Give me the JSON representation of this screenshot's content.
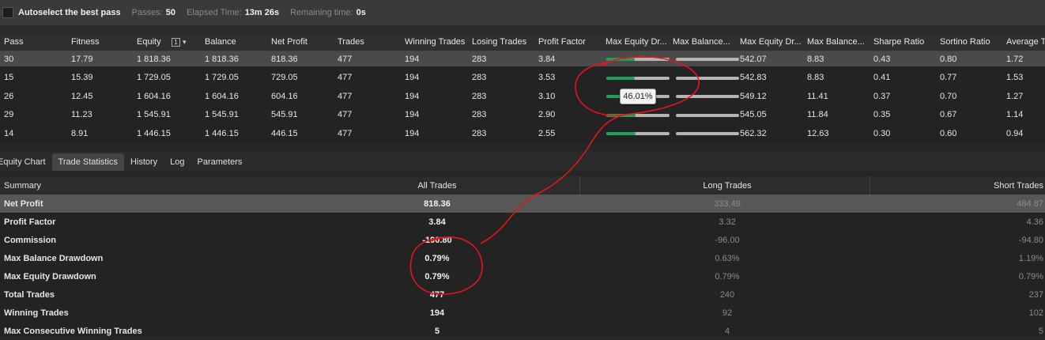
{
  "topbar": {
    "autoselect_label": "Autoselect the best pass",
    "passes_key": "Passes:",
    "passes_value": "50",
    "elapsed_key": "Elapsed Time:",
    "elapsed_value": "13m 26s",
    "remaining_key": "Remaining time:",
    "remaining_value": "0s"
  },
  "grid": {
    "columns": [
      "Pass",
      "Fitness",
      "Equity",
      "Balance",
      "Net Profit",
      "Trades",
      "Winning Trades",
      "Losing Trades",
      "Profit Factor",
      "Max Equity Dr...",
      "Max Balance...",
      "Max Equity Dr...",
      "Max Balance...",
      "Sharpe Ratio",
      "Sortino Ratio",
      "Average T"
    ],
    "equity_sort_badge": "1",
    "equity_sort_arrow": "▾",
    "rows": [
      {
        "pass": "30",
        "fitness": "17.79",
        "equity": "1 818.36",
        "balance": "1 818.36",
        "net_profit": "818.36",
        "trades": "477",
        "winning": "194",
        "losing": "283",
        "profit_factor": "3.84",
        "max_equity_dd_fill": 0.45,
        "max_balance_dd_fill": 0.0,
        "max_equity_dd_abs": "542.07",
        "max_balance_dd_abs": "8.83",
        "sharpe": "0.43",
        "sortino": "0.80",
        "average": "1.72"
      },
      {
        "pass": "15",
        "fitness": "15.39",
        "equity": "1 729.05",
        "balance": "1 729.05",
        "net_profit": "729.05",
        "trades": "477",
        "winning": "194",
        "losing": "283",
        "profit_factor": "3.53",
        "max_equity_dd_fill": 0.45,
        "max_balance_dd_fill": 0.0,
        "max_equity_dd_abs": "542.83",
        "max_balance_dd_abs": "8.83",
        "sharpe": "0.41",
        "sortino": "0.77",
        "average": "1.53"
      },
      {
        "pass": "26",
        "fitness": "12.45",
        "equity": "1 604.16",
        "balance": "1 604.16",
        "net_profit": "604.16",
        "trades": "477",
        "winning": "194",
        "losing": "283",
        "profit_factor": "3.10",
        "max_equity_dd_fill": 0.46,
        "max_balance_dd_fill": 0.0,
        "max_equity_dd_abs": "549.12",
        "max_balance_dd_abs": "11.41",
        "sharpe": "0.37",
        "sortino": "0.70",
        "average": "1.27"
      },
      {
        "pass": "29",
        "fitness": "11.23",
        "equity": "1 545.91",
        "balance": "1 545.91",
        "net_profit": "545.91",
        "trades": "477",
        "winning": "194",
        "losing": "283",
        "profit_factor": "2.90",
        "max_equity_dd_fill": 0.46,
        "max_balance_dd_fill": 0.0,
        "max_equity_dd_abs": "545.05",
        "max_balance_dd_abs": "11.84",
        "sharpe": "0.35",
        "sortino": "0.67",
        "average": "1.14"
      },
      {
        "pass": "14",
        "fitness": "8.91",
        "equity": "1 446.15",
        "balance": "1 446.15",
        "net_profit": "446.15",
        "trades": "477",
        "winning": "194",
        "losing": "283",
        "profit_factor": "2.55",
        "max_equity_dd_fill": 0.46,
        "max_balance_dd_fill": 0.0,
        "max_equity_dd_abs": "562.32",
        "max_balance_dd_abs": "12.63",
        "sharpe": "0.30",
        "sortino": "0.60",
        "average": "0.94"
      }
    ],
    "tooltip": "46.01%"
  },
  "tabs": [
    "Equity Chart",
    "Trade Statistics",
    "History",
    "Log",
    "Parameters"
  ],
  "active_tab": "Trade Statistics",
  "stats": {
    "headers": {
      "summary": "Summary",
      "all": "All Trades",
      "long": "Long Trades",
      "short": "Short Trades"
    },
    "rows": [
      {
        "label": "Net Profit",
        "all": "818.36",
        "long": "333.49",
        "short": "484.87"
      },
      {
        "label": "Profit Factor",
        "all": "3.84",
        "long": "3.32",
        "short": "4.36"
      },
      {
        "label": "Commission",
        "all": "-190.80",
        "long": "-96.00",
        "short": "-94.80"
      },
      {
        "label": "Max Balance Drawdown",
        "all": "0.79%",
        "long": "0.63%",
        "short": "1.19%"
      },
      {
        "label": "Max Equity Drawdown",
        "all": "0.79%",
        "long": "0.79%",
        "short": "0.79%"
      },
      {
        "label": "Total Trades",
        "all": "477",
        "long": "240",
        "short": "237"
      },
      {
        "label": "Winning Trades",
        "all": "194",
        "long": "92",
        "short": "102"
      },
      {
        "label": "Max Consecutive Winning Trades",
        "all": "5",
        "long": "4",
        "short": "5"
      }
    ]
  },
  "colors": {
    "bar_fill": "#1fa05a",
    "bar_track": "#b5b5b5",
    "annotation": "#e8141c"
  }
}
